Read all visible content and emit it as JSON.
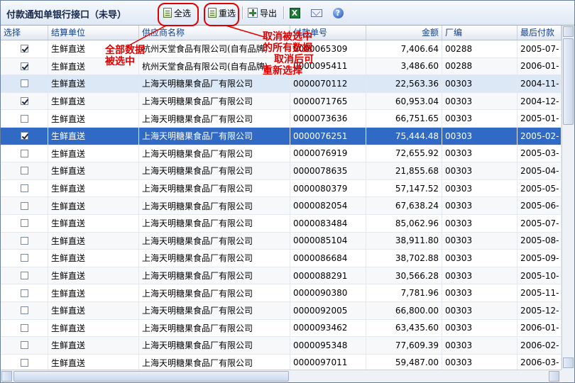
{
  "toolbar": {
    "title": "付款通知单银行接口（未导）",
    "select_all": "全选",
    "reselect": "重选",
    "export": "导出"
  },
  "icons": {
    "excel": "excel-icon",
    "mail": "mail-icon",
    "help": "help-icon"
  },
  "columns": [
    "选择",
    "结算单位",
    "供应商名称",
    "付款单号",
    "金额",
    "厂编",
    "最后付款"
  ],
  "rows": [
    {
      "checked": true,
      "unit": "生鲜直送",
      "supplier": "杭州天堂食品有限公司(自有品牌)",
      "code": "0000065309",
      "amount": "7,406.64",
      "factory": "00288",
      "date": "2005-07-"
    },
    {
      "checked": true,
      "unit": "生鲜直送",
      "supplier": "杭州天堂食品有限公司(自有品牌)",
      "code": "0000095411",
      "amount": "3,486.60",
      "factory": "00288",
      "date": "2006-01-"
    },
    {
      "checked": false,
      "unit": "生鲜直送",
      "supplier": "上海天明糖果食品厂有限公司",
      "code": "0000070112",
      "amount": "22,563.36",
      "factory": "00303",
      "date": "2004-11-"
    },
    {
      "checked": true,
      "unit": "生鲜直送",
      "supplier": "上海天明糖果食品厂有限公司",
      "code": "0000071765",
      "amount": "60,953.04",
      "factory": "00303",
      "date": "2004-12-"
    },
    {
      "checked": false,
      "unit": "生鲜直送",
      "supplier": "上海天明糖果食品厂有限公司",
      "code": "0000073636",
      "amount": "66,751.65",
      "factory": "00303",
      "date": "2005-01-"
    },
    {
      "checked": true,
      "unit": "生鲜直送",
      "supplier": "上海天明糖果食品厂有限公司",
      "code": "0000076251",
      "amount": "75,444.48",
      "factory": "00303",
      "date": "2005-02-"
    },
    {
      "checked": false,
      "unit": "生鲜直送",
      "supplier": "上海天明糖果食品厂有限公司",
      "code": "0000076919",
      "amount": "72,655.92",
      "factory": "00303",
      "date": "2005-03-"
    },
    {
      "checked": false,
      "unit": "生鲜直送",
      "supplier": "上海天明糖果食品厂有限公司",
      "code": "0000078635",
      "amount": "21,855.68",
      "factory": "00303",
      "date": "2005-04-"
    },
    {
      "checked": false,
      "unit": "生鲜直送",
      "supplier": "上海天明糖果食品厂有限公司",
      "code": "0000080379",
      "amount": "57,147.52",
      "factory": "00303",
      "date": "2005-05-"
    },
    {
      "checked": false,
      "unit": "生鲜直送",
      "supplier": "上海天明糖果食品厂有限公司",
      "code": "0000082054",
      "amount": "67,638.24",
      "factory": "00303",
      "date": "2005-06-"
    },
    {
      "checked": false,
      "unit": "生鲜直送",
      "supplier": "上海天明糖果食品厂有限公司",
      "code": "0000083484",
      "amount": "85,062.96",
      "factory": "00303",
      "date": "2005-07-"
    },
    {
      "checked": false,
      "unit": "生鲜直送",
      "supplier": "上海天明糖果食品厂有限公司",
      "code": "0000085104",
      "amount": "38,911.80",
      "factory": "00303",
      "date": "2005-08-"
    },
    {
      "checked": false,
      "unit": "生鲜直送",
      "supplier": "上海天明糖果食品厂有限公司",
      "code": "0000086684",
      "amount": "38,702.88",
      "factory": "00303",
      "date": "2005-09-"
    },
    {
      "checked": false,
      "unit": "生鲜直送",
      "supplier": "上海天明糖果食品厂有限公司",
      "code": "0000088291",
      "amount": "30,566.28",
      "factory": "00303",
      "date": "2005-10-"
    },
    {
      "checked": false,
      "unit": "生鲜直送",
      "supplier": "上海天明糖果食品厂有限公司",
      "code": "0000090380",
      "amount": "7,781.96",
      "factory": "00303",
      "date": "2005-11-"
    },
    {
      "checked": false,
      "unit": "生鲜直送",
      "supplier": "上海天明糖果食品厂有限公司",
      "code": "0000092005",
      "amount": "66,800.00",
      "factory": "00303",
      "date": "2005-12-"
    },
    {
      "checked": false,
      "unit": "生鲜直送",
      "supplier": "上海天明糖果食品厂有限公司",
      "code": "0000093462",
      "amount": "63,435.60",
      "factory": "00303",
      "date": "2006-01-"
    },
    {
      "checked": false,
      "unit": "生鲜直送",
      "supplier": "上海天明糖果食品厂有限公司",
      "code": "0000095348",
      "amount": "77,609.39",
      "factory": "00303",
      "date": "2006-02-"
    },
    {
      "checked": false,
      "unit": "生鲜直送",
      "supplier": "上海天明糖果食品厂有限公司",
      "code": "0000097011",
      "amount": "59,487.00",
      "factory": "00303",
      "date": "2006-03-"
    }
  ],
  "annotations": {
    "select_all_line1": "全部数据",
    "select_all_line2": "被选中",
    "reselect_line1": "取消被选中",
    "reselect_line2": "的所有数据",
    "reselect_line3": "取消后可",
    "reselect_line4": "重新选择"
  },
  "colors": {
    "selected_row": "#316ac5",
    "annotation": "#e00000",
    "header_text": "#15428b"
  }
}
